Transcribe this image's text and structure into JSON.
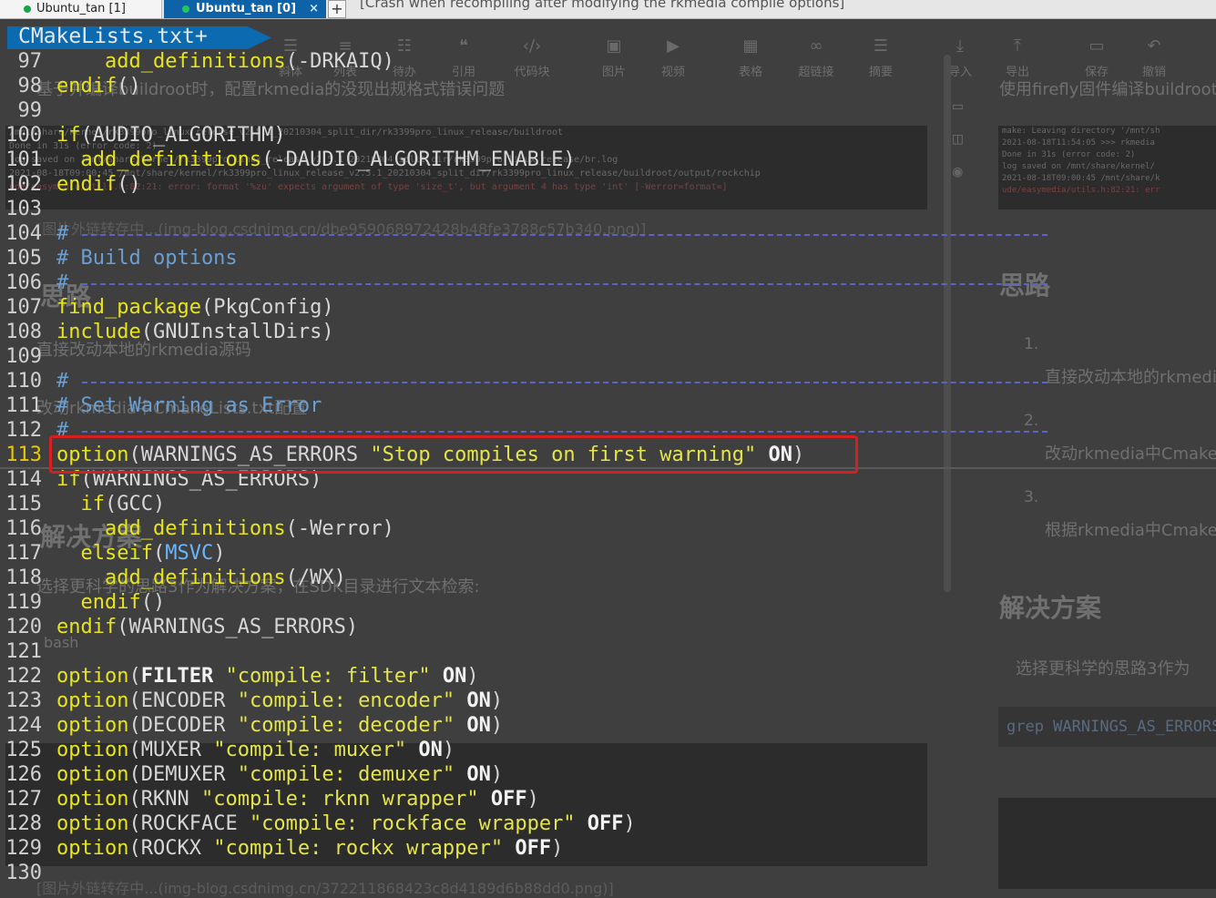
{
  "tabs": [
    {
      "label": "Ubuntu_tan [1]",
      "active": false
    },
    {
      "label": "Ubuntu_tan [0]",
      "active": true
    }
  ],
  "tab_close_glyph": "×",
  "new_tab_glyph": "+",
  "background_title": "[Crash when recompiling after modifying the rkmedia compile options]",
  "editor": {
    "file_banner": "CMakeLists.txt+",
    "current_line": "113",
    "lines": [
      {
        "n": "97",
        "tokens": [
          {
            "t": "    ",
            "c": "p"
          },
          {
            "t": "add_definitions",
            "c": "k"
          },
          {
            "t": "(-DRKAIQ)",
            "c": "p"
          }
        ]
      },
      {
        "n": "98",
        "tokens": [
          {
            "t": "endif",
            "c": "k"
          },
          {
            "t": "()",
            "c": "p"
          }
        ]
      },
      {
        "n": "99",
        "tokens": []
      },
      {
        "n": "100",
        "tokens": [
          {
            "t": "if",
            "c": "k"
          },
          {
            "t": "(AUDIO_ALGORITHM)",
            "c": "p"
          }
        ]
      },
      {
        "n": "101",
        "tokens": [
          {
            "t": "  ",
            "c": "p"
          },
          {
            "t": "add_definitions",
            "c": "k"
          },
          {
            "t": "(-DAUDIO_ALGORITHM_ENABLE)",
            "c": "p"
          }
        ]
      },
      {
        "n": "102",
        "tokens": [
          {
            "t": "endif",
            "c": "k"
          },
          {
            "t": "()",
            "c": "p"
          }
        ]
      },
      {
        "n": "103",
        "tokens": []
      },
      {
        "n": "104",
        "tokens": [
          {
            "t": "#",
            "c": "c"
          }
        ]
      },
      {
        "n": "105",
        "tokens": [
          {
            "t": "# Build options",
            "c": "c"
          }
        ]
      },
      {
        "n": "106",
        "tokens": [
          {
            "t": "#",
            "c": "c"
          }
        ]
      },
      {
        "n": "107",
        "tokens": [
          {
            "t": "find_package",
            "c": "k"
          },
          {
            "t": "(PkgConfig)",
            "c": "p"
          }
        ]
      },
      {
        "n": "108",
        "tokens": [
          {
            "t": "include",
            "c": "k"
          },
          {
            "t": "(GNUInstallDirs)",
            "c": "p"
          }
        ]
      },
      {
        "n": "109",
        "tokens": []
      },
      {
        "n": "110",
        "tokens": [
          {
            "t": "#",
            "c": "c"
          }
        ]
      },
      {
        "n": "111",
        "tokens": [
          {
            "t": "# Set Warning as Error",
            "c": "c"
          }
        ]
      },
      {
        "n": "112",
        "tokens": [
          {
            "t": "#",
            "c": "c"
          }
        ]
      },
      {
        "n": "113",
        "tokens": [
          {
            "t": "option",
            "c": "k"
          },
          {
            "t": "(WARNINGS_AS_ERRORS ",
            "c": "p"
          },
          {
            "t": "\"Stop compiles on first warning\"",
            "c": "s"
          },
          {
            "t": " ON",
            "c": "b"
          },
          {
            "t": ")",
            "c": "p"
          }
        ]
      },
      {
        "n": "114",
        "tokens": [
          {
            "t": "if",
            "c": "k"
          },
          {
            "t": "(WARNINGS_AS_ERRORS)",
            "c": "p"
          }
        ]
      },
      {
        "n": "115",
        "tokens": [
          {
            "t": "  ",
            "c": "p"
          },
          {
            "t": "if",
            "c": "k"
          },
          {
            "t": "(GCC)",
            "c": "p"
          }
        ]
      },
      {
        "n": "116",
        "tokens": [
          {
            "t": "    ",
            "c": "p"
          },
          {
            "t": "add_definitions",
            "c": "k"
          },
          {
            "t": "(-Werror)",
            "c": "p"
          }
        ]
      },
      {
        "n": "117",
        "tokens": [
          {
            "t": "  ",
            "c": "p"
          },
          {
            "t": "elseif",
            "c": "k"
          },
          {
            "t": "(",
            "c": "p"
          },
          {
            "t": "MSVC",
            "c": "m"
          },
          {
            "t": ")",
            "c": "p"
          }
        ]
      },
      {
        "n": "118",
        "tokens": [
          {
            "t": "    ",
            "c": "p"
          },
          {
            "t": "add_definitions",
            "c": "k"
          },
          {
            "t": "(/WX)",
            "c": "p"
          }
        ]
      },
      {
        "n": "119",
        "tokens": [
          {
            "t": "  ",
            "c": "p"
          },
          {
            "t": "endif",
            "c": "k"
          },
          {
            "t": "()",
            "c": "p"
          }
        ]
      },
      {
        "n": "120",
        "tokens": [
          {
            "t": "endif",
            "c": "k"
          },
          {
            "t": "(WARNINGS_AS_ERRORS)",
            "c": "p"
          }
        ]
      },
      {
        "n": "121",
        "tokens": []
      },
      {
        "n": "122",
        "tokens": [
          {
            "t": "option",
            "c": "k"
          },
          {
            "t": "(",
            "c": "p"
          },
          {
            "t": "FILTER",
            "c": "b"
          },
          {
            "t": " ",
            "c": "p"
          },
          {
            "t": "\"compile: filter\"",
            "c": "s"
          },
          {
            "t": " ON",
            "c": "b"
          },
          {
            "t": ")",
            "c": "p"
          }
        ]
      },
      {
        "n": "123",
        "tokens": [
          {
            "t": "option",
            "c": "k"
          },
          {
            "t": "(ENCODER ",
            "c": "p"
          },
          {
            "t": "\"compile: encoder\"",
            "c": "s"
          },
          {
            "t": " ON",
            "c": "b"
          },
          {
            "t": ")",
            "c": "p"
          }
        ]
      },
      {
        "n": "124",
        "tokens": [
          {
            "t": "option",
            "c": "k"
          },
          {
            "t": "(DECODER ",
            "c": "p"
          },
          {
            "t": "\"compile: decoder\"",
            "c": "s"
          },
          {
            "t": " ON",
            "c": "b"
          },
          {
            "t": ")",
            "c": "p"
          }
        ]
      },
      {
        "n": "125",
        "tokens": [
          {
            "t": "option",
            "c": "k"
          },
          {
            "t": "(MUXER ",
            "c": "p"
          },
          {
            "t": "\"compile: muxer\"",
            "c": "s"
          },
          {
            "t": " ON",
            "c": "b"
          },
          {
            "t": ")",
            "c": "p"
          }
        ]
      },
      {
        "n": "126",
        "tokens": [
          {
            "t": "option",
            "c": "k"
          },
          {
            "t": "(DEMUXER ",
            "c": "p"
          },
          {
            "t": "\"compile: demuxer\"",
            "c": "s"
          },
          {
            "t": " ON",
            "c": "b"
          },
          {
            "t": ")",
            "c": "p"
          }
        ]
      },
      {
        "n": "127",
        "tokens": [
          {
            "t": "option",
            "c": "k"
          },
          {
            "t": "(RKNN ",
            "c": "p"
          },
          {
            "t": "\"compile: rknn wrapper\"",
            "c": "s"
          },
          {
            "t": " OFF",
            "c": "b"
          },
          {
            "t": ")",
            "c": "p"
          }
        ]
      },
      {
        "n": "128",
        "tokens": [
          {
            "t": "option",
            "c": "k"
          },
          {
            "t": "(ROCKFACE ",
            "c": "p"
          },
          {
            "t": "\"compile: rockface wrapper\"",
            "c": "s"
          },
          {
            "t": " OFF",
            "c": "b"
          },
          {
            "t": ")",
            "c": "p"
          }
        ]
      },
      {
        "n": "129",
        "tokens": [
          {
            "t": "option",
            "c": "k"
          },
          {
            "t": "(ROCKX ",
            "c": "p"
          },
          {
            "t": "\"compile: rockx wrapper\"",
            "c": "s"
          },
          {
            "t": " OFF",
            "c": "b"
          },
          {
            "t": ")",
            "c": "p"
          }
        ]
      },
      {
        "n": "130",
        "tokens": []
      }
    ]
  },
  "background_editor": {
    "toolbar": [
      {
        "icon": "list-icon",
        "glyph": "☰",
        "label": "斜体"
      },
      {
        "icon": "ordered-list-icon",
        "glyph": "≡",
        "label": "列表"
      },
      {
        "icon": "indent-icon",
        "glyph": "☷",
        "label": "待办"
      },
      {
        "icon": "quote-icon",
        "glyph": "❝",
        "label": "引用"
      },
      {
        "icon": "code-icon",
        "glyph": "‹/›",
        "label": "代码块"
      },
      {
        "icon": "image-icon",
        "glyph": "▣",
        "label": "图片"
      },
      {
        "icon": "video-icon",
        "glyph": "▶",
        "label": "视频"
      },
      {
        "icon": "table-icon",
        "glyph": "▦",
        "label": "表格"
      },
      {
        "icon": "link-icon",
        "glyph": "∞",
        "label": "超链接"
      },
      {
        "icon": "summary-icon",
        "glyph": "☰",
        "label": "摘要"
      },
      {
        "icon": "import-icon",
        "glyph": "⤓",
        "label": "导入"
      },
      {
        "icon": "export-icon",
        "glyph": "⤒",
        "label": "导出"
      },
      {
        "icon": "save-icon",
        "glyph": "▭",
        "label": "保存"
      },
      {
        "icon": "undo-icon",
        "glyph": "↶",
        "label": "撤销"
      }
    ],
    "left_texts": [
      "基于并编译buildroot时，配置rkmedia的没现出规格式错误问题",
      "思路",
      "直接改动本地的rkmedia源码",
      "改动rkmedia中CmakeLists.txt配置",
      "解决方案",
      "选择更科学的思路3作为解决方案，在SDK目录进行文本检索:",
      "bash"
    ],
    "right_texts": [
      "使用firefly固件编译buildroot",
      "思路",
      "1.",
      "直接改动本地的rkmedia",
      "2.",
      "改动rkmedia中Cmake",
      "3.",
      "根据rkmedia中Cmake",
      "解决方案",
      "选择更科学的思路3作为",
      "grep WARNINGS_AS_ERRORS"
    ],
    "panel_lines": [
      "/mnt/share/kernel/rk3399pro_linux_release_v2.5.1_20210304_split_dir/rk3399pro_linux_release/buildroot",
      "Done in 31s  (error code: 2)",
      "log saved on /mnt/share/kernel/rk3399pro_linux_release_v2.5.1_20210304_split_dir/rk3399pro_linux_release/br.log",
      "2021-08-18T09:00:45 /mnt/share/kernel/rk3399pro_linux_release_v2.5.1_20210304_split_dir/rk3399pro_linux_release/buildroot/output/rockchip",
      "ude/easymedia/utils.h:82:21: error: format '%zu' expects argument of type 'size_t', but argument 4 has type 'int' [-Werror=format=]"
    ],
    "right_panel_lines": [
      "make: Leaving directory '/mnt/sh",
      "2021-08-18T11:54:05 >>> rkmedia",
      "Done in 31s  (error code: 2)",
      "log saved on /mnt/share/kernel/",
      "2021-08-18T09:00:45 /mnt/share/k",
      "ude/easymedia/utils.h:82:21: err"
    ],
    "image_link": "[图片外链转存中...(img-blog.csdnimg.cn/dbe959068972428b48fe3788c57b340.png)]",
    "image_link_2": "[图片外链转存中...(img-blog.csdnimg.cn/372211868423c8d4189d6b88dd0.png)]"
  },
  "colors": {
    "active_tab": "#0e63a8",
    "banner": "#0b6ab0",
    "keyword": "#e6e41c",
    "comment": "#6a9fd4",
    "highlight_box": "#d62020"
  }
}
